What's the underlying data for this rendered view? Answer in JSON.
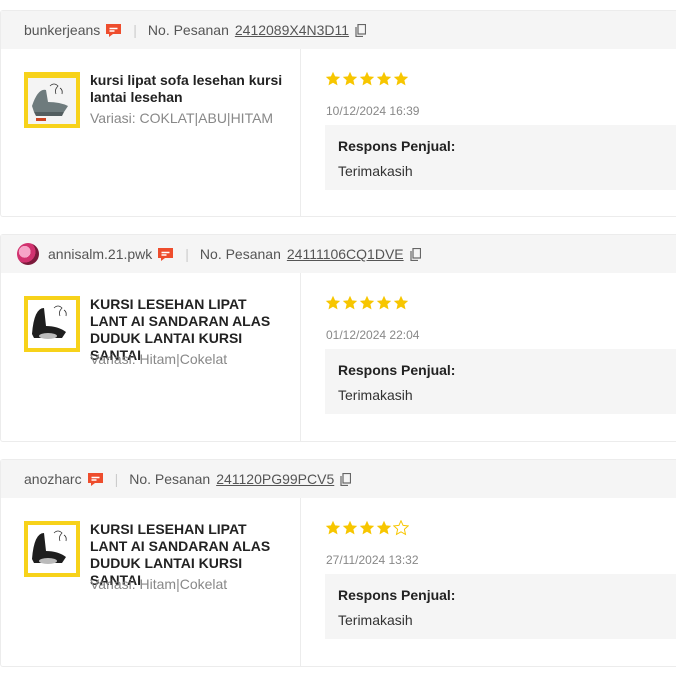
{
  "colors": {
    "star": "#f7c600",
    "chat_icon": "#ee4d2d",
    "accent_yellow": "#f7d21a"
  },
  "reviews": [
    {
      "username": "bunkerjeans",
      "has_avatar": false,
      "order_label": "No. Pesanan",
      "order_no": "2412089X4N3D11",
      "product_name": "kursi lipat sofa lesehan kursi lantai lesehan",
      "variation": "Variasi: COKLAT|ABU|HITAM",
      "rating": 5,
      "date": "10/12/2024 16:39",
      "response_label": "Respons Penjual:",
      "response_text": "Terimakasih"
    },
    {
      "username": "annisalm.21.pwk",
      "has_avatar": true,
      "order_label": "No. Pesanan",
      "order_no": "24111106CQ1DVE",
      "product_name": "KURSI LESEHAN LIPAT LANT AI SANDARAN ALAS DUDUK LANTAI KURSI SANTAI",
      "variation": "Variasi: Hitam|Cokelat",
      "rating": 5,
      "date": "01/12/2024 22:04",
      "response_label": "Respons Penjual:",
      "response_text": "Terimakasih"
    },
    {
      "username": "anozharc",
      "has_avatar": false,
      "order_label": "No. Pesanan",
      "order_no": "241120PG99PCV5",
      "product_name": "KURSI LESEHAN LIPAT LANT AI SANDARAN ALAS DUDUK LANTAI KURSI SANTAI",
      "variation": "Variasi: Hitam|Cokelat",
      "rating": 4,
      "date": "27/11/2024 13:32",
      "response_label": "Respons Penjual:",
      "response_text": "Terimakasih"
    }
  ]
}
